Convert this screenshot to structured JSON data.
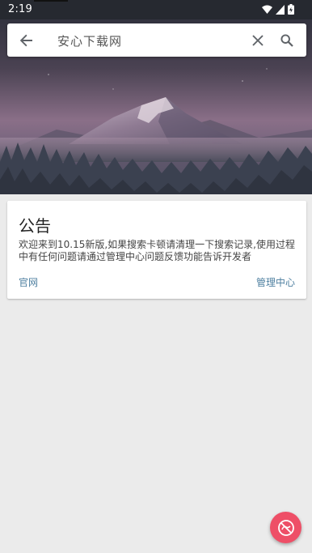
{
  "status_bar": {
    "time": "2:19",
    "icons": [
      "wifi-icon",
      "signal-icon",
      "battery-icon"
    ]
  },
  "search": {
    "query": "安心下载网",
    "back_icon": "arrow-left-icon",
    "clear_icon": "close-icon",
    "search_icon": "search-icon"
  },
  "hero": {
    "image": "mountain-night-landscape"
  },
  "notice": {
    "title": "公告",
    "body": "欢迎来到10.15新版,如果搜索卡顿请清理一下搜索记录,使用过程中有任何问题请通过管理中心问题反馈功能告诉开发者",
    "link_left": "官网",
    "link_right": "管理中心"
  },
  "fab": {
    "icon": "no-ads-icon"
  },
  "colors": {
    "accent": "#4e7fa0",
    "fab": "#ee4f67",
    "background": "#ebebeb",
    "status_bar": "#262930"
  }
}
